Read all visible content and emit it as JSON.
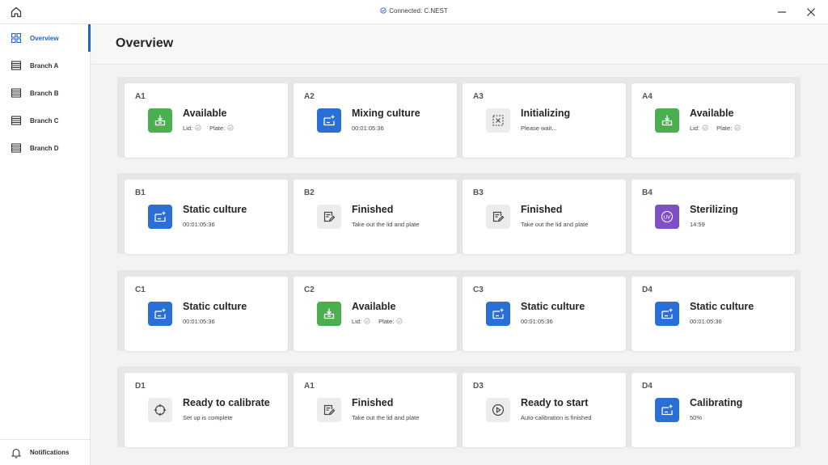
{
  "titlebar": {
    "connection": "Connected: C.NEST"
  },
  "sidebar": {
    "items": [
      {
        "label": "Overview"
      },
      {
        "label": "Branch A"
      },
      {
        "label": "Branch B"
      },
      {
        "label": "Branch C"
      },
      {
        "label": "Branch D"
      }
    ],
    "notifications": "Notifications"
  },
  "page": {
    "title": "Overview"
  },
  "colors": {
    "accent": "#1f63c9",
    "available": "#4caf4f",
    "running": "#2a6fd6",
    "sterilizing": "#7e4fc7",
    "neutral": "#ececec"
  },
  "cards": [
    {
      "id": "A1",
      "status": "Available",
      "lid": "Lid:",
      "plate": "Plate:",
      "icon": "tray-icon"
    },
    {
      "id": "A2",
      "status": "Mixing culture",
      "sub": "00:01:05:36",
      "icon": "culture-icon"
    },
    {
      "id": "A3",
      "status": "Initializing",
      "sub": "Please wait...",
      "icon": "initializing-icon"
    },
    {
      "id": "A4",
      "status": "Available",
      "lid": "Lid:",
      "plate": "Plate:",
      "icon": "tray-icon"
    },
    {
      "id": "B1",
      "status": "Static culture",
      "sub": "00:01:05:36",
      "icon": "culture-icon"
    },
    {
      "id": "B2",
      "status": "Finished",
      "sub": "Take out the lid and plate",
      "icon": "finished-icon"
    },
    {
      "id": "B3",
      "status": "Finished",
      "sub": "Take out the lid and plate",
      "icon": "finished-icon"
    },
    {
      "id": "B4",
      "status": "Sterilizing",
      "sub": "14:59",
      "icon": "uv-icon",
      "icon_text": "UV"
    },
    {
      "id": "C1",
      "status": "Static culture",
      "sub": "00:01:05:36",
      "icon": "culture-icon"
    },
    {
      "id": "C2",
      "status": "Available",
      "lid": "Lid:",
      "plate": "Plate:",
      "icon": "tray-icon"
    },
    {
      "id": "C3",
      "status": "Static culture",
      "sub": "00:01:05:36",
      "icon": "culture-icon"
    },
    {
      "id": "D4",
      "status": "Static culture",
      "sub": "00:01:05:36",
      "icon": "culture-icon"
    },
    {
      "id": "D1",
      "status": "Ready to calibrate",
      "sub": "Set up is complete",
      "icon": "crosshair-icon"
    },
    {
      "id": "A1",
      "status": "Finished",
      "sub": "Take out the lid and plate",
      "icon": "finished-icon"
    },
    {
      "id": "D3",
      "status": "Ready to start",
      "sub": "Auto-calibration is finished",
      "icon": "play-icon"
    },
    {
      "id": "D4",
      "status": "Calibrating",
      "sub": "50%",
      "icon": "culture-icon"
    }
  ]
}
